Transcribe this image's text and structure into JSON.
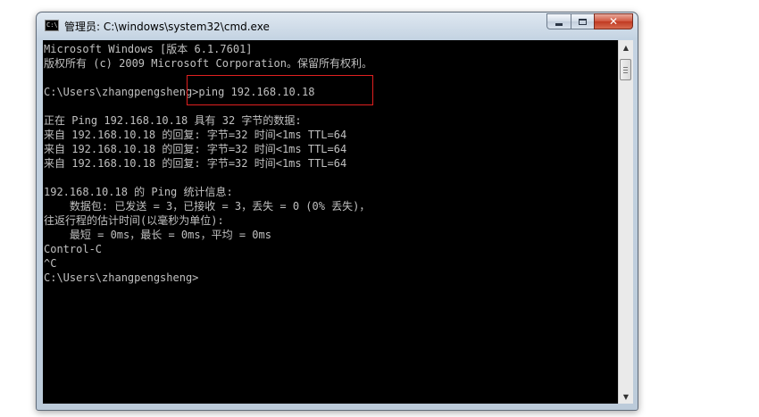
{
  "window": {
    "title": "管理员: C:\\windows\\system32\\cmd.exe",
    "icon": "cmd-icon",
    "icon_glyph": "C:\\",
    "buttons": {
      "minimize": "minimize-icon",
      "maximize": "maximize-icon",
      "close": "close-icon",
      "close_glyph": "✕"
    }
  },
  "console": {
    "lines": [
      "Microsoft Windows [版本 6.1.7601]",
      "版权所有 (c) 2009 Microsoft Corporation。保留所有权利。",
      "",
      "C:\\Users\\zhangpengsheng>ping 192.168.10.18",
      "",
      "正在 Ping 192.168.10.18 具有 32 字节的数据:",
      "来自 192.168.10.18 的回复: 字节=32 时间<1ms TTL=64",
      "来自 192.168.10.18 的回复: 字节=32 时间<1ms TTL=64",
      "来自 192.168.10.18 的回复: 字节=32 时间<1ms TTL=64",
      "",
      "192.168.10.18 的 Ping 统计信息:",
      "    数据包: 已发送 = 3，已接收 = 3，丢失 = 0 (0% 丢失)，",
      "往返行程的估计时间(以毫秒为单位):",
      "    最短 = 0ms，最长 = 0ms，平均 = 0ms",
      "Control-C",
      "^C",
      "C:\\Users\\zhangpengsheng>"
    ],
    "text_color": "#c0c0c0",
    "background": "#000000"
  },
  "scrollbar": {
    "up_glyph": "▲",
    "down_glyph": "▼"
  },
  "annotation": {
    "color": "#e02020"
  }
}
